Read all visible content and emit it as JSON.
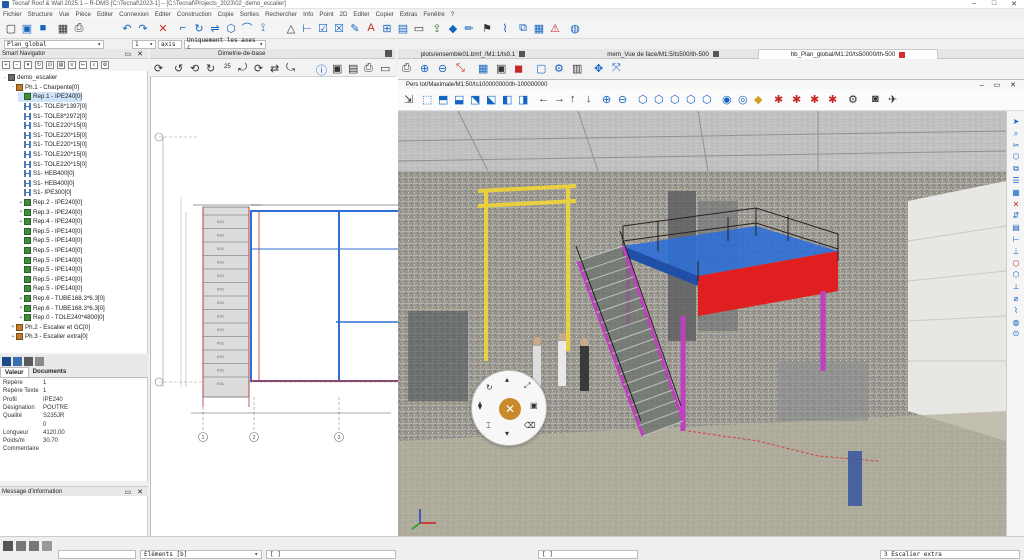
{
  "window": {
    "title": "Tecnaf Roof & Wall 2025.1 – R-DMS [C:\\Tecnaf\\2023-1] – [C:\\Tecnaf\\Projects_2023\\02_demo_escalier]"
  },
  "menu": [
    "Fichier",
    "Structure",
    "Vue",
    "Pièce",
    "Editer",
    "Connexion",
    "Editer",
    "Construction",
    "Copie",
    "Sorties",
    "Rechercher",
    "Info",
    "Point",
    "2D",
    "Editer",
    "Copier",
    "Extras",
    "Fenêtre",
    "?"
  ],
  "combos": {
    "layer": "Plan_global",
    "scale": "1",
    "mode": "axis",
    "filter": "Uniquement les axes c"
  },
  "navigator": {
    "title": "Smart Navigator",
    "items": [
      {
        "label": "demo_escalier",
        "level": 0,
        "expander": "-",
        "icon": "root"
      },
      {
        "label": "Ph.1 - Charpente[0]",
        "level": 1,
        "expander": "-",
        "icon": "ph"
      },
      {
        "label": "Rep.1 - IPE240[0]",
        "level": 2,
        "expander": "",
        "icon": "rep",
        "selected": true
      },
      {
        "label": "S1- TOLE8*1397[0]",
        "level": 2,
        "expander": "",
        "icon": "beam"
      },
      {
        "label": "S1- TOLE8*2972[0]",
        "level": 2,
        "expander": "",
        "icon": "beam"
      },
      {
        "label": "S1- TOLE220*15[0]",
        "level": 2,
        "expander": "",
        "icon": "beam"
      },
      {
        "label": "S1- TOLE220*15[0]",
        "level": 2,
        "expander": "",
        "icon": "beam"
      },
      {
        "label": "S1- TOLE220*15[0]",
        "level": 2,
        "expander": "",
        "icon": "beam"
      },
      {
        "label": "S1- TOLE220*15[0]",
        "level": 2,
        "expander": "",
        "icon": "beam"
      },
      {
        "label": "S1- TOLE220*15[0]",
        "level": 2,
        "expander": "",
        "icon": "beam"
      },
      {
        "label": "S1- HEB400[0]",
        "level": 2,
        "expander": "",
        "icon": "beam"
      },
      {
        "label": "S1- HEB400[0]",
        "level": 2,
        "expander": "",
        "icon": "beam"
      },
      {
        "label": "S1- IPE300[0]",
        "level": 2,
        "expander": "",
        "icon": "beam"
      },
      {
        "label": "Rep.2 - IPE240[0]",
        "level": 2,
        "expander": "+",
        "icon": "rep"
      },
      {
        "label": "Rep.3 - IPE240[0]",
        "level": 2,
        "expander": "+",
        "icon": "rep"
      },
      {
        "label": "Rep.4 - IPE240[0]",
        "level": 2,
        "expander": "+",
        "icon": "rep"
      },
      {
        "label": "Rep.5 - IPE140[0]",
        "level": 2,
        "expander": "",
        "icon": "rep"
      },
      {
        "label": "Rep.5 - IPE140[0]",
        "level": 2,
        "expander": "",
        "icon": "rep"
      },
      {
        "label": "Rep.5 - IPE140[0]",
        "level": 2,
        "expander": "",
        "icon": "rep"
      },
      {
        "label": "Rep.5 - IPE140[0]",
        "level": 2,
        "expander": "",
        "icon": "rep"
      },
      {
        "label": "Rep.5 - IPE140[0]",
        "level": 2,
        "expander": "",
        "icon": "rep"
      },
      {
        "label": "Rep.5 - IPE140[0]",
        "level": 2,
        "expander": "",
        "icon": "rep"
      },
      {
        "label": "Rep.5 - IPE140[0]",
        "level": 2,
        "expander": "",
        "icon": "rep"
      },
      {
        "label": "Rep.6 - TUBE168.3*6.3[0]",
        "level": 2,
        "expander": "+",
        "icon": "rep"
      },
      {
        "label": "Rep.6 - TUBE168.3*6.3[0]",
        "level": 2,
        "expander": "+",
        "icon": "rep"
      },
      {
        "label": "Rep.0 - TOLE240*4800[0]",
        "level": 2,
        "expander": "+",
        "icon": "rep"
      },
      {
        "label": "Ph.2 - Escalier et GC[0]",
        "level": 1,
        "expander": "+",
        "icon": "ph"
      },
      {
        "label": "Ph.3 - Escalier extra[0]",
        "level": 1,
        "expander": "+",
        "icon": "ph"
      }
    ]
  },
  "properties": {
    "tabs": [
      "Valeur",
      "Documents"
    ],
    "rows": [
      {
        "key": "Repère",
        "value": "1"
      },
      {
        "key": "Repère Texte",
        "value": "1"
      },
      {
        "key": "Profil",
        "value": "IPE240"
      },
      {
        "key": "Désignation",
        "value": "POUTRE"
      },
      {
        "key": "Qualité",
        "value": "S235JR"
      },
      {
        "key": "",
        "value": "0"
      },
      {
        "key": "Longueur",
        "value": "4120.00"
      },
      {
        "key": "Poids/m",
        "value": "30.70"
      },
      {
        "key": "Commentaire",
        "value": ""
      }
    ]
  },
  "messages": {
    "title": "Message d'information"
  },
  "views": {
    "drawing_tab": "Dimetrie-de-base",
    "tabs": [
      {
        "label": "plots/ensemble01.bmf_/M1:1/ts0.1",
        "active": false
      },
      {
        "label": "mem_Vue de face/M1:5/ts500/th-500",
        "active": false
      },
      {
        "label": "hb_Plan_global/M1:20/ts50000/th-500",
        "active": true
      }
    ],
    "view3d_title": "Pers tot/Maximale/M1:50/ts100000000/th-100000000"
  },
  "drawing": {
    "stair_labels": [
      "K01",
      "K01",
      "K01",
      "K01",
      "K01",
      "K01",
      "K01",
      "K01",
      "K01",
      "K01",
      "K01",
      "K01",
      "K01"
    ],
    "axis_labels": [
      "1",
      "2",
      "3"
    ],
    "zoom_value": "25"
  },
  "status": {
    "elements_field": "Eléments [b]",
    "bracket_field": "[ ]",
    "bracket_field2": "[ ]",
    "escalier": "3   Escalier extra"
  },
  "colors": {
    "accent": "#1e5aa8",
    "stair_magenta": "#c03ec0",
    "platform_blue": "#2f6fd6",
    "platform_red": "#e02020",
    "gantry_yellow": "#e8d040",
    "radial_center": "#c98a2c"
  }
}
